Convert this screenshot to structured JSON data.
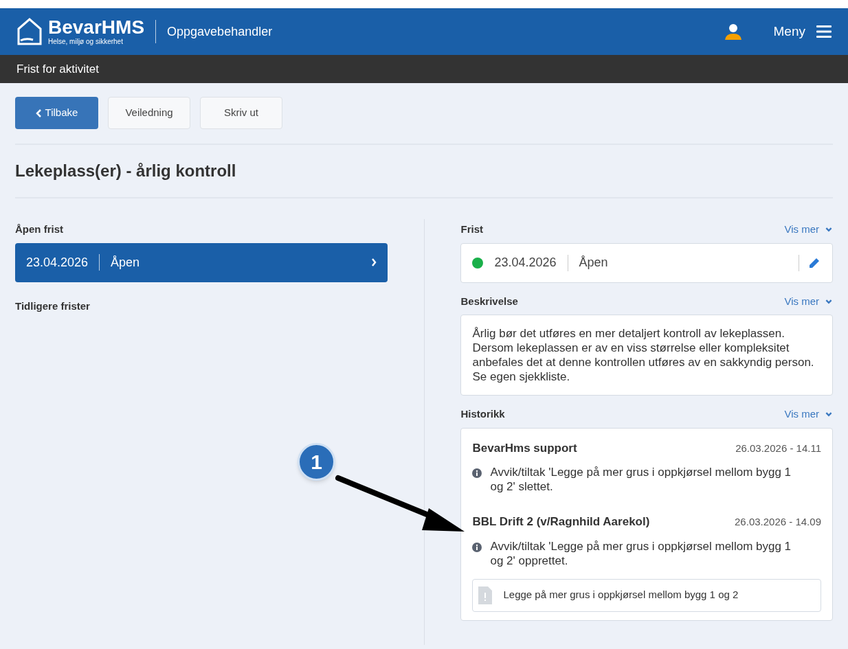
{
  "header": {
    "brand": "BevarHMS",
    "tagline": "Helse, miljø og sikkerhet",
    "app_title": "Oppgavebehandler",
    "menu_label": "Meny"
  },
  "subheader": {
    "title": "Frist for aktivitet"
  },
  "toolbar": [
    {
      "label": "Tilbake",
      "kind": "back"
    },
    {
      "label": "Veiledning",
      "kind": "plain"
    },
    {
      "label": "Skriv ut",
      "kind": "plain"
    }
  ],
  "page_title": "Lekeplass(er) - årlig kontroll",
  "left": {
    "open_label": "Åpen frist",
    "open_deadline": {
      "date": "23.04.2026",
      "status": "Åpen"
    },
    "previous_label": "Tidligere frister"
  },
  "right": {
    "sections": [
      {
        "kind": "deadline",
        "title": "Frist",
        "more": "Vis mer",
        "date": "23.04.2026",
        "status": "Åpen",
        "color": "#1ab04a"
      },
      {
        "kind": "text",
        "title": "Beskrivelse",
        "more": "Vis mer",
        "text": "Årlig bør det utføres en mer detaljert kontroll av lekeplassen. Dersom lekeplassen er av en viss størrelse eller kompleksitet anbefales det at denne kontrollen utføres av en sakkyndig person. Se egen sjekkliste."
      },
      {
        "kind": "history",
        "title": "Historikk",
        "more": "Vis mer",
        "entries": [
          {
            "author": "BevarHms support",
            "time": "26.03.2026 - 14.11",
            "message": "Avvik/tiltak 'Legge på mer grus i oppkjørsel mellom bygg 1 og 2' slettet."
          },
          {
            "author": "BBL Drift 2 (v/Ragnhild Aarekol)",
            "time": "26.03.2026 - 14.09",
            "message": "Avvik/tiltak 'Legge på mer grus i oppkjørsel mellom bygg 1 og 2' opprettet.",
            "attachment": "Legge på mer grus i oppkjørsel mellom bygg 1 og 2"
          }
        ]
      }
    ]
  },
  "callout": {
    "number": "1"
  }
}
